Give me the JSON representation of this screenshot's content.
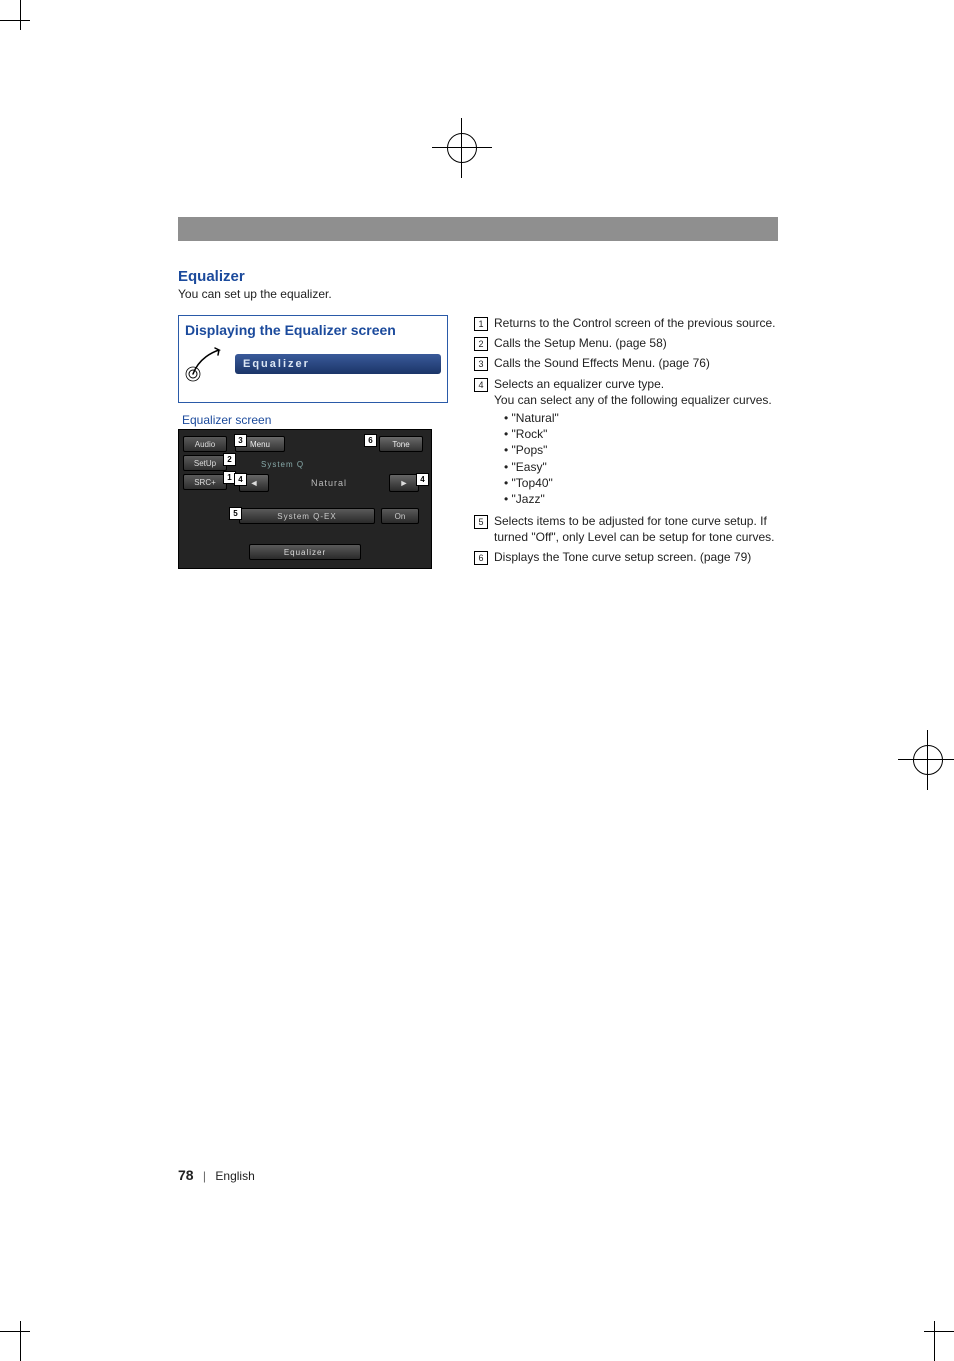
{
  "section_title": "Equalizer",
  "section_sub": "You can set up the equalizer.",
  "box_title": "Displaying the Equalizer screen",
  "eq_pill_label": "Equalizer",
  "eq_screen_label": "Equalizer screen",
  "eq_screen": {
    "tab_audio": "Audio",
    "tab_setup": "SetUp",
    "tab_src": "SRC+",
    "menu_btn": "Menu",
    "tone_btn": "Tone",
    "sysq_label": "System Q",
    "curve_value": "Natural",
    "qex_label": "System Q-EX",
    "qex_value": "On",
    "footer": "Equalizer"
  },
  "callouts": {
    "c1": "1",
    "c2": "2",
    "c3": "3",
    "c4l": "4",
    "c4r": "4",
    "c5": "5",
    "c6": "6"
  },
  "descriptions": {
    "d1": "Returns to the Control screen of the previous source.",
    "d2": "Calls the Setup Menu. (page 58)",
    "d3": "Calls the Sound Effects Menu. (page 76)",
    "d4_line1": "Selects an equalizer curve type.",
    "d4_line2": "You can select any of the following equalizer curves.",
    "d4_opts": {
      "o1": "\"Natural\"",
      "o2": "\"Rock\"",
      "o3": "\"Pops\"",
      "o4": "\"Easy\"",
      "o5": "\"Top40\"",
      "o6": "\"Jazz\""
    },
    "d5": "Selects items to be adjusted for tone curve setup. If turned \"Off\", only Level can be setup for tone curves.",
    "d6": "Displays the Tone curve setup screen. (page 79)"
  },
  "footer": {
    "page_num": "78",
    "lang": "English"
  }
}
